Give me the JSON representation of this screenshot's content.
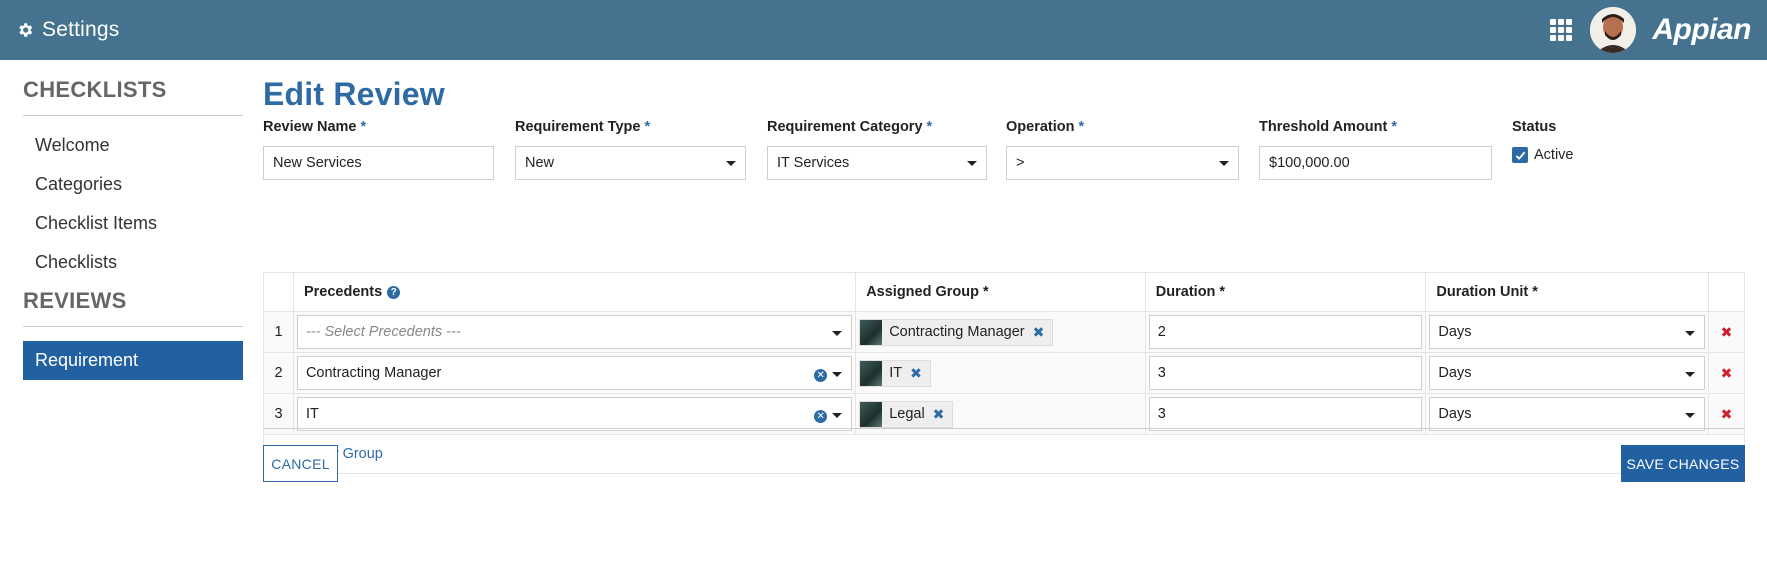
{
  "header": {
    "title": "Settings",
    "logo": "Appian",
    "icons": {
      "settings": "gear-icon",
      "apps": "app-grid-icon"
    }
  },
  "sidebar": {
    "sections": [
      {
        "heading": "CHECKLISTS",
        "items": [
          "Welcome",
          "Categories",
          "Checklist Items",
          "Checklists"
        ]
      },
      {
        "heading": "REVIEWS",
        "items": [
          "Requirement"
        ]
      }
    ],
    "active_item": "Requirement"
  },
  "main": {
    "title": "Edit Review",
    "required_mark": "*",
    "fields": {
      "review_name": {
        "label": "Review Name",
        "value": "New Services"
      },
      "requirement_type": {
        "label": "Requirement Type",
        "value": "New"
      },
      "requirement_category": {
        "label": "Requirement Category",
        "value": "IT Services"
      },
      "operation": {
        "label": "Operation",
        "value": ">"
      },
      "threshold_amount": {
        "label": "Threshold Amount",
        "value": "$100,000.00"
      },
      "status": {
        "label": "Status",
        "value": "Active",
        "checked": true
      }
    },
    "grid": {
      "headers": {
        "precedents": "Precedents",
        "assigned_group": "Assigned Group *",
        "duration": "Duration *",
        "duration_unit": "Duration Unit *"
      },
      "rows": [
        {
          "num": "1",
          "precedent": "",
          "precedent_placeholder": "--- Select Precedents ---",
          "group": "Contracting Manager",
          "duration": "2",
          "unit": "Days"
        },
        {
          "num": "2",
          "precedent": "Contracting Manager",
          "group": "IT",
          "duration": "3",
          "unit": "Days"
        },
        {
          "num": "3",
          "precedent": "IT",
          "group": "Legal",
          "duration": "3",
          "unit": "Days"
        }
      ],
      "add_label": "Review Group"
    },
    "buttons": {
      "cancel": "CANCEL",
      "save": "SAVE CHANGES"
    }
  },
  "colors": {
    "header_bg": "#45738f",
    "accent": "#2160a1",
    "delete": "#d0202e"
  }
}
